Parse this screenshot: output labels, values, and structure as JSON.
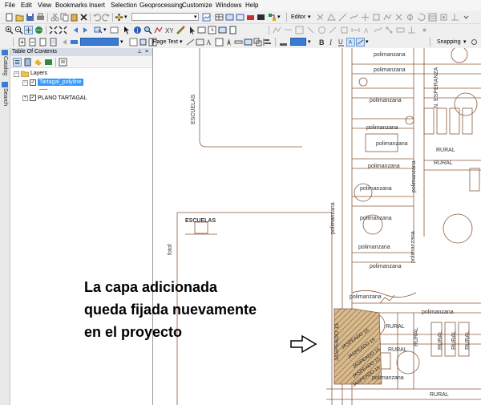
{
  "menu": [
    "File",
    "Edit",
    "View",
    "Bookmarks",
    "Insert",
    "Selection",
    "Geoprocessing",
    "Customize",
    "Windows",
    "Help"
  ],
  "toolbar": {
    "scale_value": "",
    "editor_label": "Editor",
    "page_text_label": "Page Text",
    "snapping_label": "Snapping"
  },
  "side_tabs": [
    "Catalog",
    "Search"
  ],
  "toc": {
    "title": "Table Of Contents",
    "root": "Layers",
    "layer1": "Tartagal_polyline",
    "layer2": "PLANO TARTAGAL"
  },
  "map": {
    "labels": {
      "escuelas_v": "ESCUELAS",
      "escuelas_h": "ESCUELAS",
      "fotof": "fotof",
      "n_esperanza": "N. ESPERANZA",
      "jaspeado_v": "JASPEADO 15",
      "polimanzana": "polimanzana",
      "rural": "RURAL",
      "jaspeado": "JASPEADO 15"
    },
    "annotation": [
      "La capa adicionada",
      "queda fijada nuevamente",
      "en el proyecto"
    ]
  },
  "colors": {
    "highlight": "#3399ff",
    "map_line": "#8a5a3c",
    "hatch": "#c7a67a"
  }
}
